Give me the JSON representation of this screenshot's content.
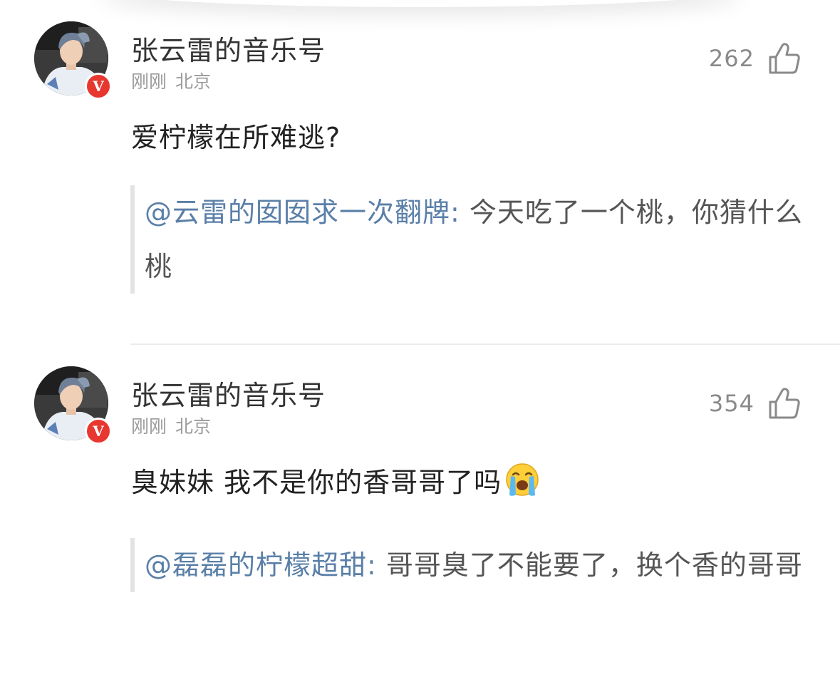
{
  "comments": [
    {
      "username": "张云雷的音乐号",
      "time": "刚刚",
      "location": "北京",
      "likes": "262",
      "text": "爱柠檬在所难逃?",
      "emoji": "",
      "reply": {
        "mention": "@云雷的囡囡求一次翻牌",
        "separator": ":",
        "text": " 今天吃了一个桃，你猜什么桃"
      }
    },
    {
      "username": "张云雷的音乐号",
      "time": "刚刚",
      "location": "北京",
      "likes": "354",
      "text": "臭妹妹 我不是你的香哥哥了吗",
      "emoji": "crying-face",
      "reply": {
        "mention": "@磊磊的柠檬超甜",
        "separator": ":",
        "text": " 哥哥臭了不能要了，换个香的哥哥"
      }
    }
  ],
  "verified_badge": "V",
  "colors": {
    "mention": "#5a7fa8",
    "badge": "#e8372f",
    "meta": "#9b9b9b",
    "quote_bar": "#e3e3e3"
  },
  "icons": {
    "like": "thumbs-up-icon",
    "verified": "verified-v-badge-icon",
    "emoji": "crying-face-emoji-icon"
  }
}
